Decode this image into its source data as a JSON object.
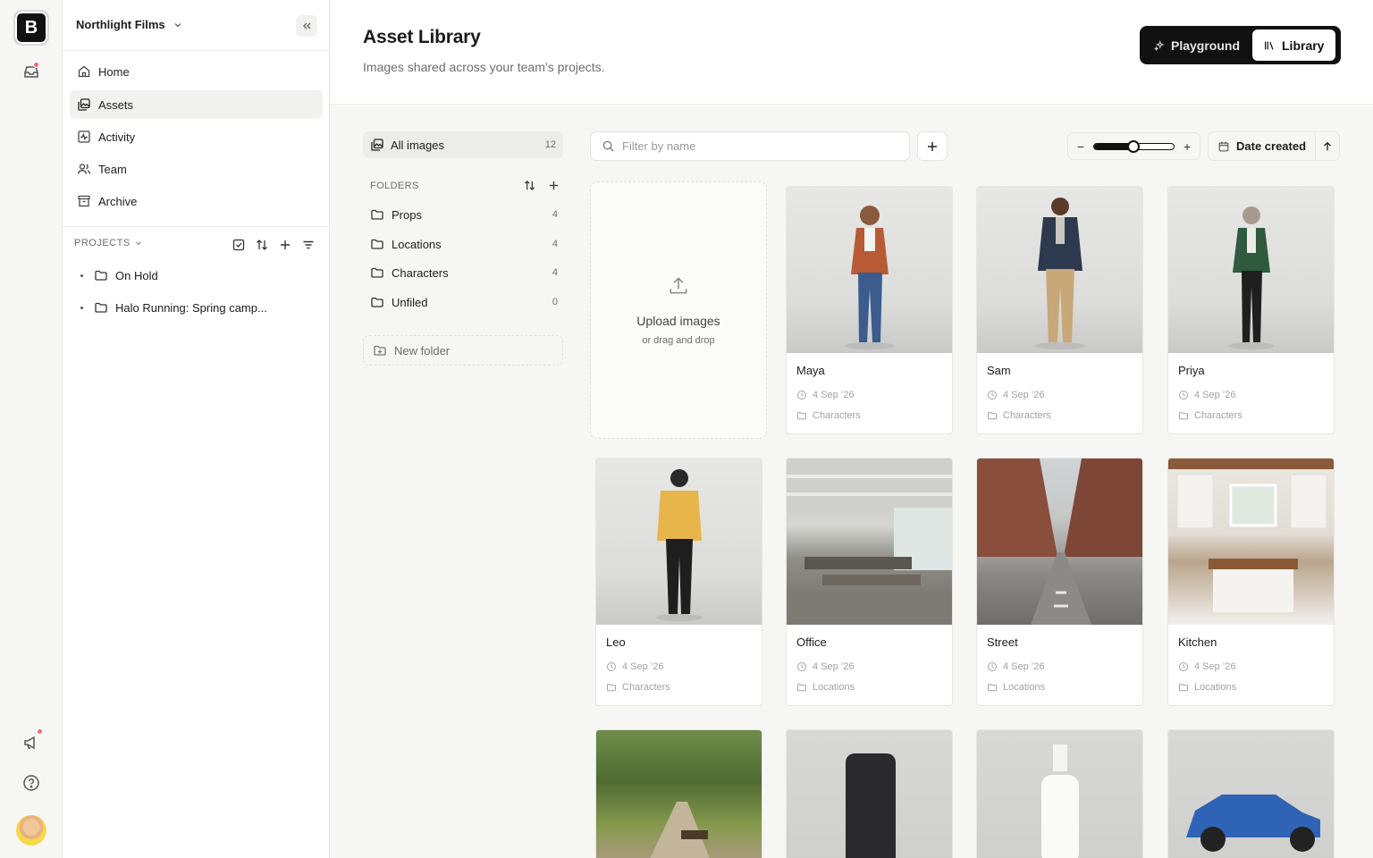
{
  "app": {
    "logo_letter": "B",
    "workspace": "Northlight Films"
  },
  "nav": [
    {
      "label": "Home",
      "icon": "home-icon"
    },
    {
      "label": "Assets",
      "icon": "images-icon",
      "active": true
    },
    {
      "label": "Activity",
      "icon": "activity-icon"
    },
    {
      "label": "Team",
      "icon": "users-icon"
    },
    {
      "label": "Archive",
      "icon": "archive-icon"
    }
  ],
  "projects": {
    "heading": "PROJECTS",
    "items": [
      "On Hold",
      "Halo Running: Spring camp..."
    ]
  },
  "header": {
    "title": "Asset Library",
    "subtitle": "Images shared across your team’s projects.",
    "modes": [
      "Playground",
      "Library"
    ],
    "active_mode": "Library"
  },
  "folders_panel": {
    "all_images_label": "All images",
    "all_images_count": "12",
    "heading": "FOLDERS",
    "folders": [
      {
        "name": "Props",
        "count": "4"
      },
      {
        "name": "Locations",
        "count": "4"
      },
      {
        "name": "Characters",
        "count": "4"
      },
      {
        "name": "Unfiled",
        "count": "0"
      }
    ],
    "new_folder_label": "New folder"
  },
  "toolbar": {
    "search_placeholder": "Filter by name",
    "zoom_level": 0.5,
    "sort_label": "Date created"
  },
  "upload": {
    "title": "Upload images",
    "hint": "or drag and drop"
  },
  "assets": [
    {
      "name": "Maya",
      "date": "4 Sep ’26",
      "folder": "Characters"
    },
    {
      "name": "Sam",
      "date": "4 Sep ’26",
      "folder": "Characters"
    },
    {
      "name": "Priya",
      "date": "4 Sep ’26",
      "folder": "Characters"
    },
    {
      "name": "Leo",
      "date": "4 Sep ’26",
      "folder": "Characters"
    },
    {
      "name": "Office",
      "date": "4 Sep ’26",
      "folder": "Locations"
    },
    {
      "name": "Street",
      "date": "4 Sep ’26",
      "folder": "Locations"
    },
    {
      "name": "Kitchen",
      "date": "4 Sep ’26",
      "folder": "Locations"
    }
  ],
  "colors": {
    "accent": "#111111",
    "notification": "#f06a7d"
  }
}
